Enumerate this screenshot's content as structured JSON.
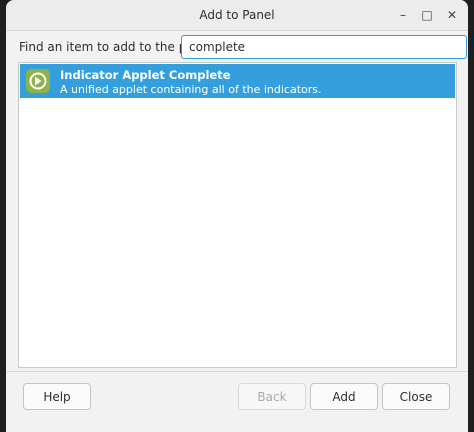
{
  "window": {
    "title": "Add to Panel",
    "controls": {
      "minimize": "–",
      "maximize": "□",
      "close": "✕"
    }
  },
  "search": {
    "label": "Find an item to add to the panel:",
    "value": "complete",
    "placeholder": ""
  },
  "list": {
    "items": [
      {
        "title": "Indicator Applet Complete",
        "description": "A unified applet containing all of the indicators.",
        "icon": "indicator-applet-icon",
        "selected": true
      }
    ]
  },
  "buttons": {
    "help": "Help",
    "back": "Back",
    "add": "Add",
    "close": "Close"
  },
  "colors": {
    "selection": "#359fde",
    "icon": "#8fb24a",
    "focus_border": "#3a9ad9"
  }
}
